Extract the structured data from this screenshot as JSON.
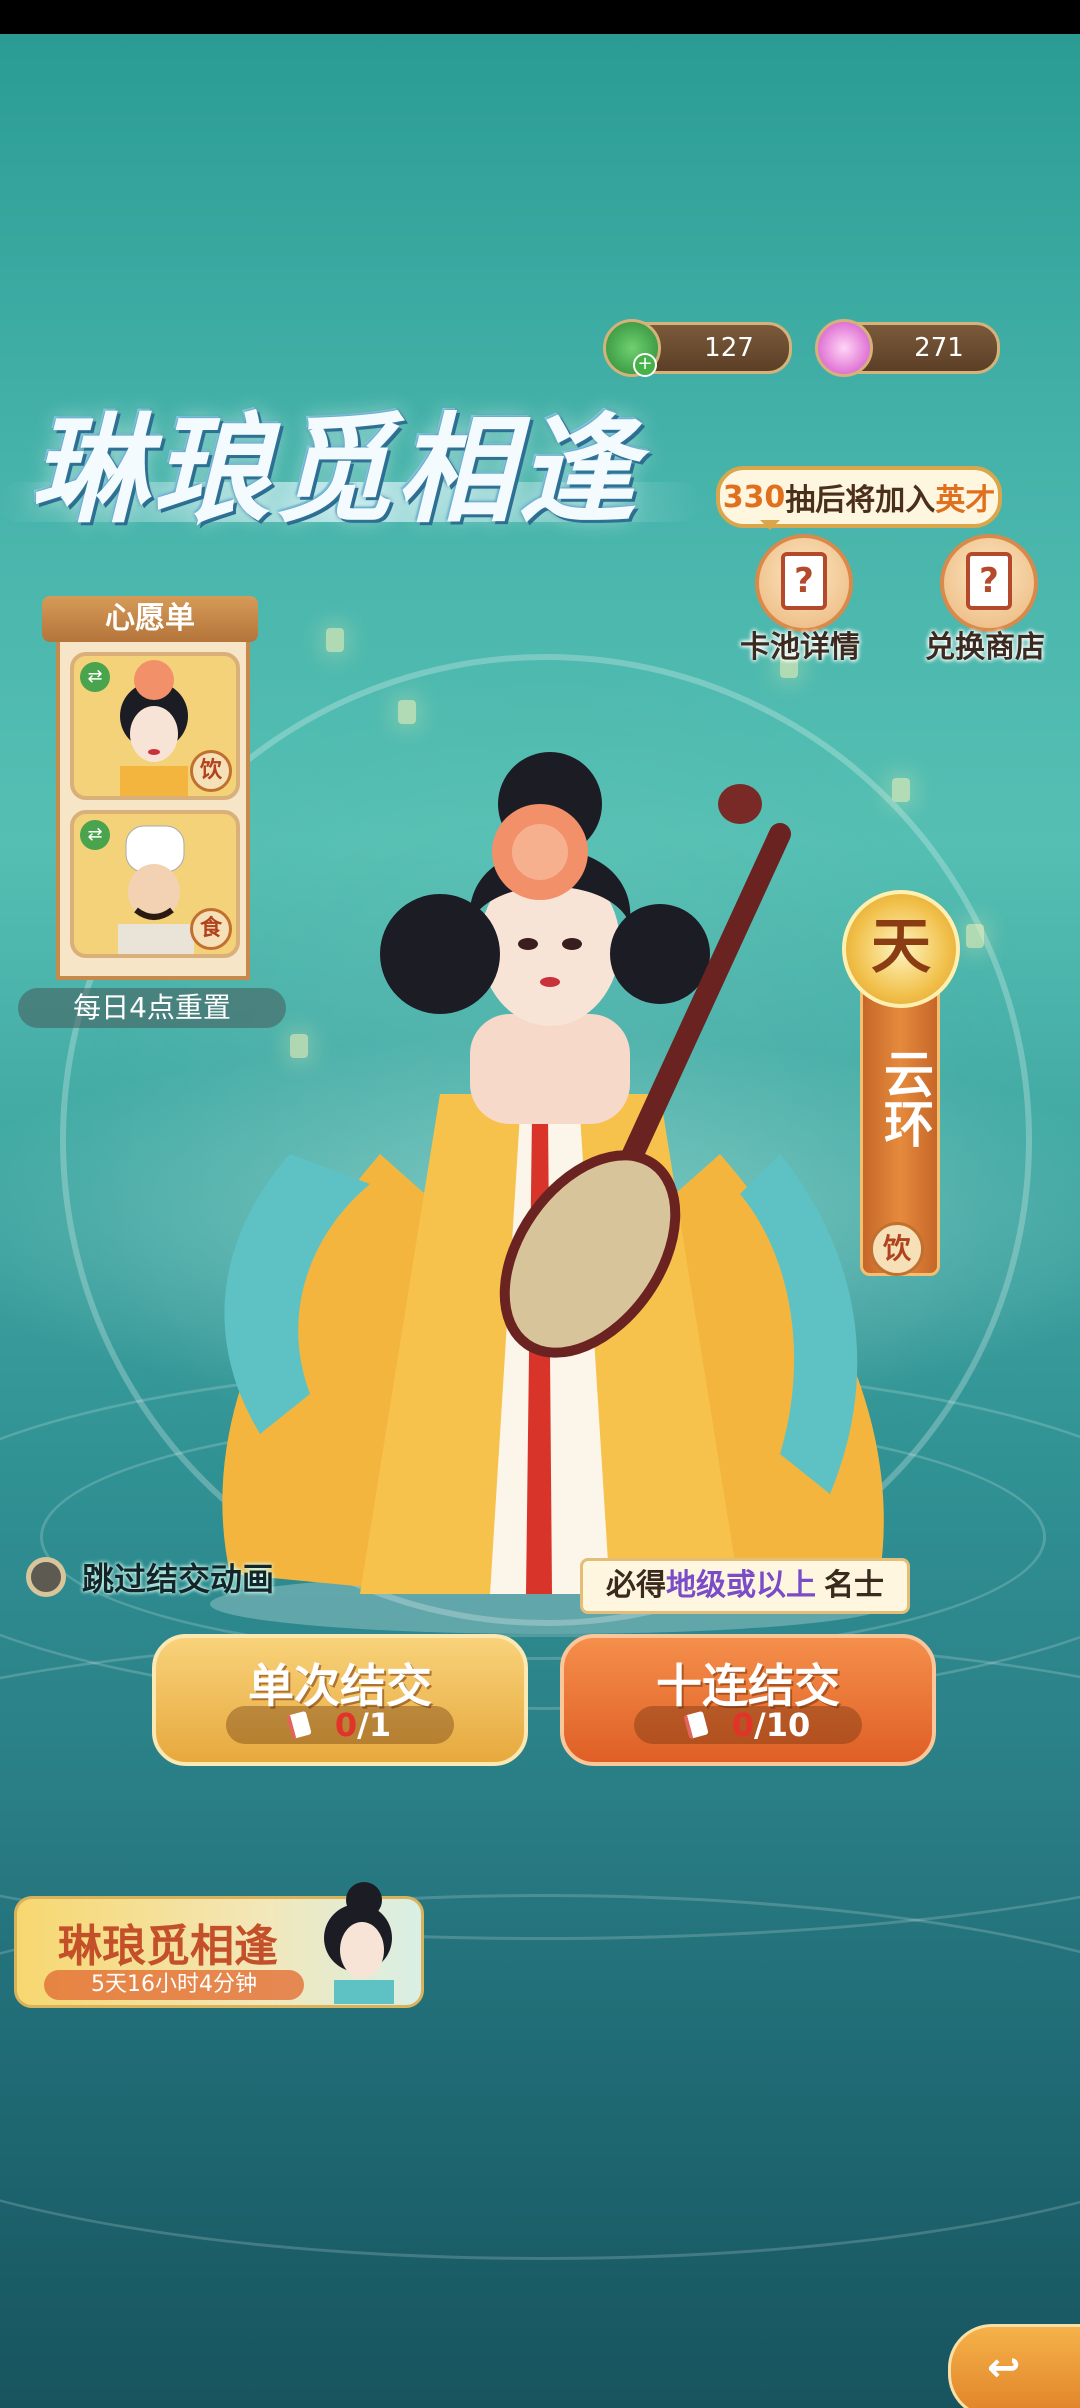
{
  "currency": [
    {
      "icon": "jade-coin-icon",
      "value": "127"
    },
    {
      "icon": "pink-gem-icon",
      "value": "271"
    }
  ],
  "banner_title": "琳琅觅相逢",
  "join_notice": {
    "count": "330",
    "mid": "抽后将加入",
    "highlight": "英才"
  },
  "buttons": {
    "pool_details": "卡池详情",
    "exchange_shop": "兑换商店",
    "pool_icon_glyph": "?",
    "shop_icon_glyph": "?"
  },
  "wishlist": {
    "title": "心愿单",
    "slots": [
      {
        "tag": "饮",
        "swap_icon": "⇄"
      },
      {
        "tag": "食",
        "swap_icon": "⇄"
      }
    ],
    "reset_text": "每日4点重置"
  },
  "featured": {
    "rank": "天",
    "name": "云环",
    "tag": "饮"
  },
  "skip_animation": "跳过结交动画",
  "guarantee": {
    "prefix": "必得",
    "highlight1": "地级",
    "mid": "或",
    "highlight2": "以上",
    "suffix": "名士"
  },
  "draw_single": {
    "label": "单次结交",
    "owned": "0",
    "cost": "/1"
  },
  "draw_ten": {
    "label": "十连结交",
    "owned": "0",
    "cost": "/10"
  },
  "event": {
    "title": "琳琅觅相逢",
    "time_left": "5天16小时4分钟"
  },
  "back_icon": "↩"
}
